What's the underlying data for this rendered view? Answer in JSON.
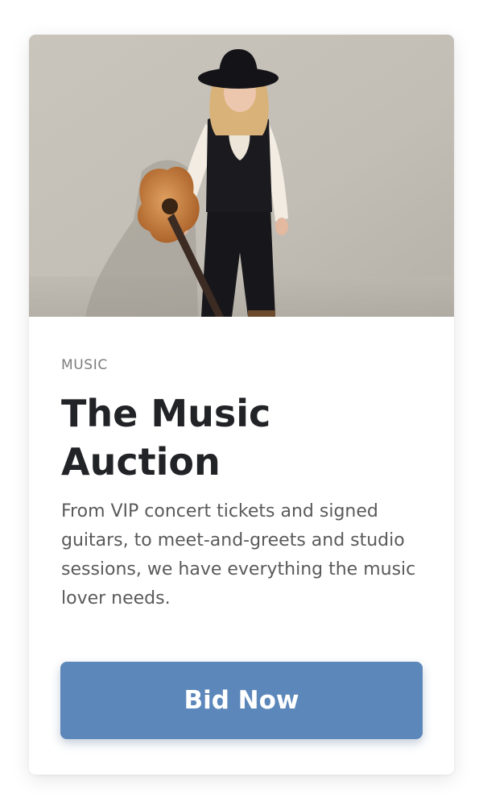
{
  "card": {
    "category": "MUSIC",
    "title": "The Music Auction",
    "description": "From VIP concert tickets and signed guitars, to meet-and-greets and studio sessions, we have everything the music lover needs.",
    "button_label": "Bid Now"
  },
  "colors": {
    "button_background": "#5b87ba",
    "title_text": "#222326",
    "body_text": "#5a5a5a",
    "category_text": "#7c7c7c"
  }
}
